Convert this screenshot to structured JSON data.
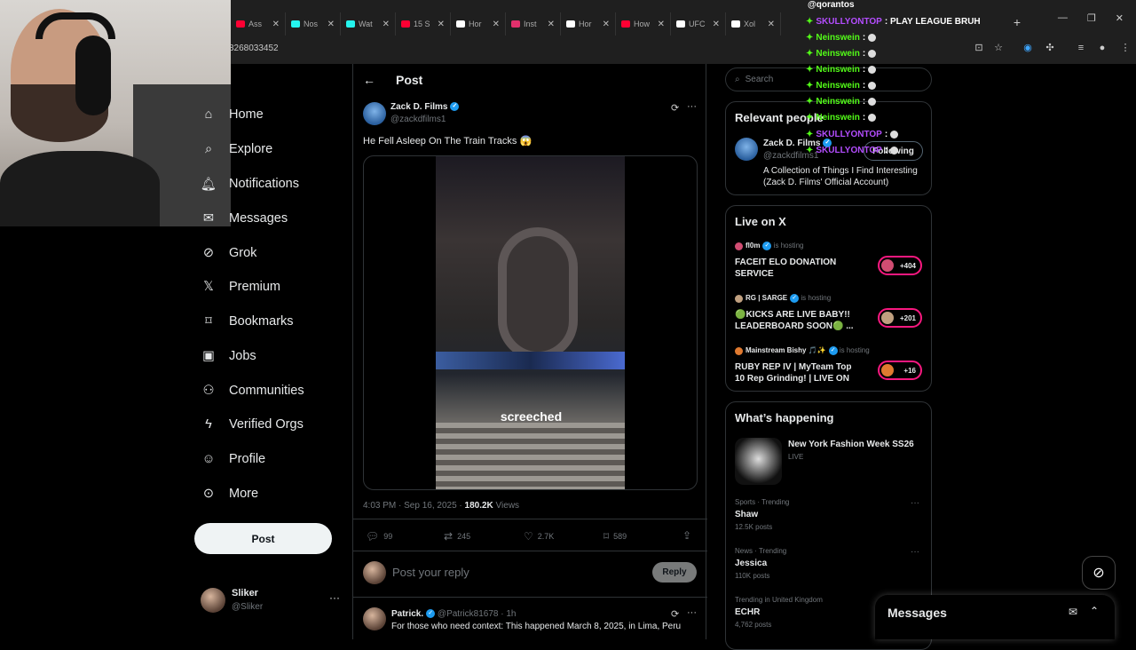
{
  "browser": {
    "tabs": [
      {
        "label": "Ass",
        "color": "#ff0033"
      },
      {
        "label": "Nos",
        "color": "#25f4ee"
      },
      {
        "label": "Wat",
        "color": "#25f4ee"
      },
      {
        "label": "15 S",
        "color": "#ff0033"
      },
      {
        "label": "Hor",
        "color": "#ffffff"
      },
      {
        "label": "Inst",
        "color": "#e1306c"
      },
      {
        "label": "Hor",
        "color": "#ffffff"
      },
      {
        "label": "How",
        "color": "#ff0033"
      },
      {
        "label": "UFC",
        "color": "#ffffff"
      },
      {
        "label": "Xol",
        "color": "#ffffff"
      }
    ],
    "url_fragment": "8268033452"
  },
  "nav": {
    "items": [
      {
        "label": "Home",
        "icon": "home-icon"
      },
      {
        "label": "Explore",
        "icon": "search-icon"
      },
      {
        "label": "Notifications",
        "icon": "bell-icon"
      },
      {
        "label": "Messages",
        "icon": "mail-icon"
      },
      {
        "label": "Grok",
        "icon": "grok-icon"
      },
      {
        "label": "Premium",
        "icon": "x-logo-icon"
      },
      {
        "label": "Bookmarks",
        "icon": "bookmark-icon"
      },
      {
        "label": "Jobs",
        "icon": "briefcase-icon"
      },
      {
        "label": "Communities",
        "icon": "people-icon"
      },
      {
        "label": "Verified Orgs",
        "icon": "bolt-icon"
      },
      {
        "label": "Profile",
        "icon": "person-icon"
      },
      {
        "label": "More",
        "icon": "more-circle-icon"
      }
    ],
    "post_button": "Post",
    "account": {
      "name": "Sliker",
      "handle": "@Sliker"
    }
  },
  "main": {
    "header": "Post",
    "tweet": {
      "author": "Zack D. Films",
      "handle": "@zackdfilms1",
      "text": "He Fell Asleep On The Train Tracks 😱",
      "video_caption": "screeched",
      "time": "4:03 PM · Sep 16, 2025 · ",
      "views_count": "180.2K",
      "views_label": " Views",
      "replies": "99",
      "reposts": "245",
      "likes": "2.7K",
      "bookmarks": "589"
    },
    "reply_placeholder": "Post your reply",
    "reply_button": "Reply",
    "next_reply": {
      "author": "Patrick.",
      "handle": "@Patrick81678",
      "time": "· 1h",
      "text": "For those who need context: This happened March 8, 2025, in Lima, Peru"
    }
  },
  "sidebar": {
    "search_placeholder": "Search",
    "relevant": {
      "title": "Relevant people",
      "name": "Zack D. Films",
      "handle": "@zackdfilms1",
      "bio": "A Collection of Things I Find Interesting (Zack D. Films' Official Account)",
      "follow_label": "Following"
    },
    "live": {
      "title": "Live on X",
      "items": [
        {
          "host": "fl0m",
          "suffix": "is hosting",
          "title": "FACEIT ELO DONATION SERVICE",
          "count": "+404"
        },
        {
          "host": "RG | SARGE",
          "suffix": "is hosting",
          "title": "🟢KICKS ARE LIVE BABY!! LEADERBOARD SOON🟢 ...",
          "count": "+201"
        },
        {
          "host": "Mainstream Bishy 🎵✨",
          "suffix": "is hosting",
          "title": "RUBY REP IV | MyTeam Top 10 Rep Grinding! | LIVE ON ...",
          "count": "+16"
        }
      ]
    },
    "happening": {
      "title": "What’s happening",
      "featured": {
        "title": "New York Fashion Week SS26",
        "sub": "LIVE"
      },
      "trends": [
        {
          "context": "Sports · Trending",
          "name": "Shaw",
          "posts": "12.5K posts"
        },
        {
          "context": "News · Trending",
          "name": "Jessica",
          "posts": "110K posts"
        },
        {
          "context": "Trending in United Kingdom",
          "name": "ECHR",
          "posts": "4,762 posts"
        }
      ]
    }
  },
  "messages_drawer": {
    "title": "Messages"
  },
  "chat": {
    "header": "@qorantos",
    "lines": [
      {
        "user": "SKULLYONTOP",
        "msg": ": PLAY LEAGUE BRUH",
        "color": "purple"
      },
      {
        "user": "Neinswein",
        "msg": ":",
        "color": "green"
      },
      {
        "user": "Neinswein",
        "msg": ":",
        "color": "green"
      },
      {
        "user": "Neinswein",
        "msg": ":",
        "color": "green"
      },
      {
        "user": "Neinswein",
        "msg": ":",
        "color": "green"
      },
      {
        "user": "Neinswein",
        "msg": ":",
        "color": "green"
      },
      {
        "user": "Neinswein",
        "msg": ":",
        "color": "green"
      },
      {
        "user": "SKULLYONTOP",
        "msg": ":",
        "color": "purple"
      },
      {
        "user": "SKULLYONTOP",
        "msg": ":",
        "color": "purple"
      }
    ]
  },
  "colors": {
    "accent": "#1d9bf0",
    "live_red": "#f91880",
    "kick_green": "#53fc18"
  }
}
